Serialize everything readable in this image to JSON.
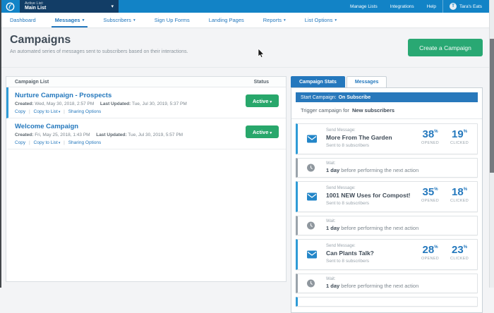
{
  "topbar": {
    "active_list_label": "Active List:",
    "active_list_value": "Main List",
    "manage_lists": "Manage Lists",
    "integrations": "Integrations",
    "help": "Help",
    "user_initial": "T",
    "user_name": "Tara's Eats"
  },
  "nav": {
    "items": [
      {
        "label": "Dashboard"
      },
      {
        "label": "Messages"
      },
      {
        "label": "Subscribers"
      },
      {
        "label": "Sign Up Forms"
      },
      {
        "label": "Landing Pages"
      },
      {
        "label": "Reports"
      },
      {
        "label": "List Options"
      }
    ]
  },
  "header": {
    "title": "Campaigns",
    "subtitle": "An automated series of messages sent to subscribers based on their interactions.",
    "create_button": "Create a Campaign"
  },
  "campaign_list": {
    "header_title": "Campaign List",
    "header_status": "Status",
    "divider": "|",
    "items": [
      {
        "title": "Nurture Campaign - Prospects",
        "created_label": "Created:",
        "created": "Wed, May 30, 2018, 2:57 PM",
        "updated_label": "Last Updated:",
        "updated": "Tue, Jul 30, 2019, 5:37 PM",
        "action_copy": "Copy",
        "action_copy_to_list": "Copy to List",
        "action_sharing": "Sharing Options",
        "status": "Active"
      },
      {
        "title": "Welcome Campaign",
        "created_label": "Created:",
        "created": "Fri, May 25, 2018, 1:43 PM",
        "updated_label": "Last Updated:",
        "updated": "Tue, Jul 30, 2019, 5:57 PM",
        "action_copy": "Copy",
        "action_copy_to_list": "Copy to List",
        "action_sharing": "Sharing Options",
        "status": "Active"
      }
    ]
  },
  "stats_panel": {
    "tabs": [
      {
        "label": "Campaign Stats"
      },
      {
        "label": "Messages"
      }
    ],
    "start_label": "Start Campaign:",
    "start_value": "On Subscribe",
    "trigger_prefix": "Trigger campaign for",
    "trigger_bold": "New subscribers",
    "steps": [
      {
        "type": "message",
        "kicker": "Send Message:",
        "title": "More From The Garden",
        "sent": "Sent to 8 subscribers",
        "opened_value": "38",
        "opened_unit": "%",
        "opened_label": "OPENED",
        "clicked_value": "19",
        "clicked_unit": "%",
        "clicked_label": "CLICKED"
      },
      {
        "type": "wait",
        "kicker": "Wait:",
        "duration": "1 day",
        "text": "before performing the next action"
      },
      {
        "type": "message",
        "kicker": "Send Message:",
        "title": "1001 NEW Uses for Compost!",
        "sent": "Sent to 8 subscribers",
        "opened_value": "35",
        "opened_unit": "%",
        "opened_label": "OPENED",
        "clicked_value": "18",
        "clicked_unit": "%",
        "clicked_label": "CLICKED"
      },
      {
        "type": "wait",
        "kicker": "Wait:",
        "duration": "1 day",
        "text": "before performing the next action"
      },
      {
        "type": "message",
        "kicker": "Send Message:",
        "title": "Can Plants Talk?",
        "sent": "Sent to 8 subscribers",
        "opened_value": "28",
        "opened_unit": "%",
        "opened_label": "OPENED",
        "clicked_value": "23",
        "clicked_unit": "%",
        "clicked_label": "CLICKED"
      },
      {
        "type": "wait",
        "kicker": "Wait:",
        "duration": "1 day",
        "text": "before performing the next action"
      }
    ]
  },
  "icons": {
    "chevron_down": "▾"
  },
  "colors": {
    "topbar_blue": "#1283c6",
    "navy": "#123d66",
    "accent_blue": "#2478bd",
    "green": "#29a873",
    "selected_border": "#2e9bd6"
  }
}
